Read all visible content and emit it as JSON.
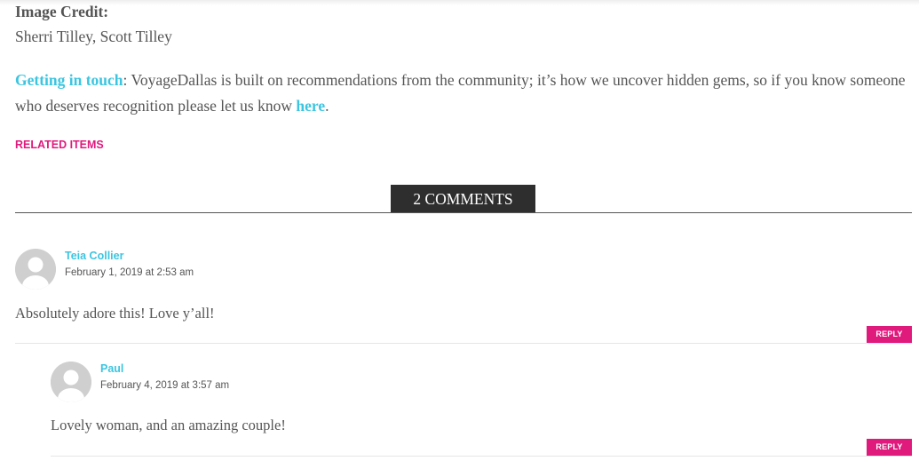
{
  "image_credit": {
    "label": "Image Credit:",
    "names": "Sherri Tilley, Scott Tilley"
  },
  "getting_in_touch": {
    "link_label": "Getting in touch",
    "text_before_here": ": VoyageDallas is built on recommendations from the community; it’s how we uncover hidden gems, so if you know someone who deserves recognition please let us know ",
    "here_link": "here",
    "text_after": "."
  },
  "related_items": "RELATED ITEMS",
  "comments": {
    "heading": "2 COMMENTS",
    "items": [
      {
        "author": "Teia Collier",
        "date": "February 1, 2019 at 2:53 am",
        "text": "Absolutely adore this! Love y’all!",
        "reply_label": "REPLY"
      },
      {
        "author": "Paul",
        "date": "February 4, 2019 at 3:57 am",
        "text": "Lovely woman, and an amazing couple!",
        "reply_label": "REPLY"
      }
    ]
  },
  "colors": {
    "link": "#3cc5e0",
    "accent_pink": "#e0197d",
    "heading_bg": "#2e2e2e",
    "text": "#555555"
  },
  "icons": {
    "avatar": "default-user-avatar-icon"
  }
}
